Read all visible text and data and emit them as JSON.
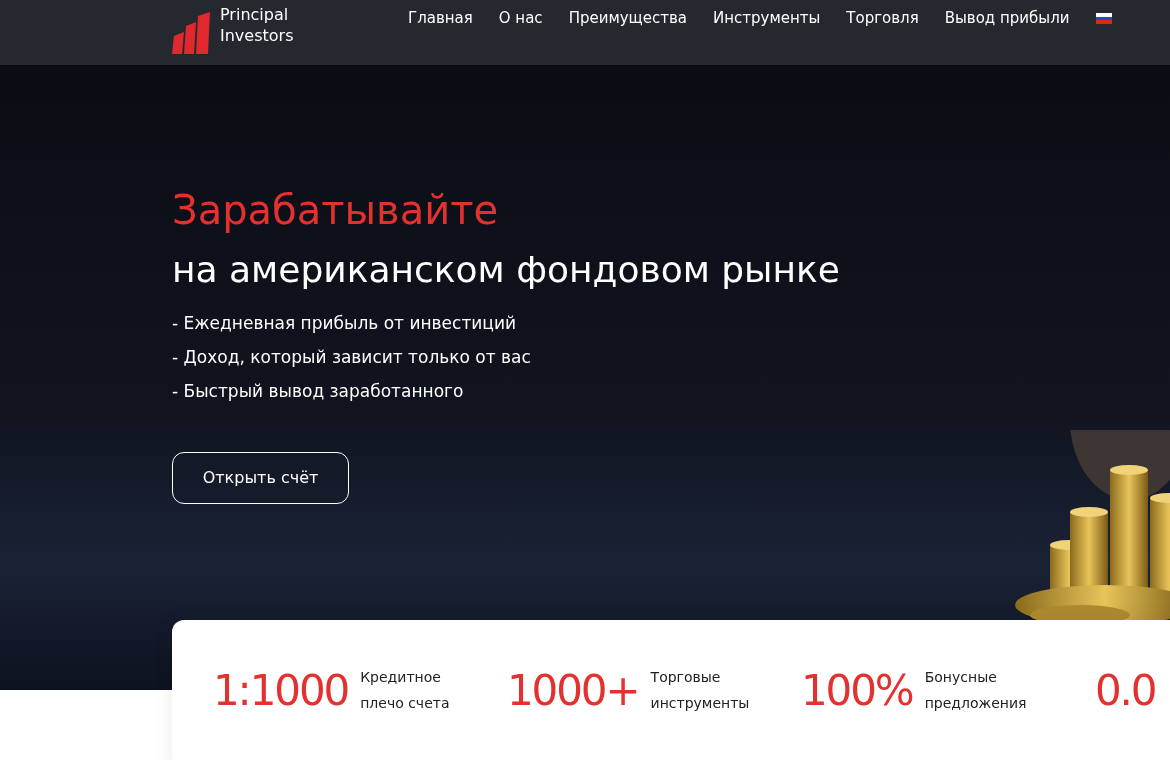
{
  "header": {
    "logo_lines": [
      "Principal",
      "Investors"
    ],
    "nav": [
      {
        "label": "Главная"
      },
      {
        "label": "О нас"
      },
      {
        "label": "Преимущества"
      },
      {
        "label": "Инструменты"
      },
      {
        "label": "Торговля"
      },
      {
        "label": "Вывод прибыли"
      }
    ]
  },
  "hero": {
    "title_accent": "Зарабатывайте",
    "title": "на американском фондовом рынке",
    "bullets": [
      "- Ежедневная прибыль от инвестиций",
      "- Доход, который зависит только от вас",
      "- Быстрый вывод заработанного"
    ],
    "button": "Открыть счёт"
  },
  "stats": [
    {
      "value": "1:1000",
      "label": "Кредитное плечо счета"
    },
    {
      "value": "1000+",
      "label": "Торговые инструменты"
    },
    {
      "value": "100%",
      "label": "Бонусные предложения"
    },
    {
      "value": "0.0"
    }
  ]
}
